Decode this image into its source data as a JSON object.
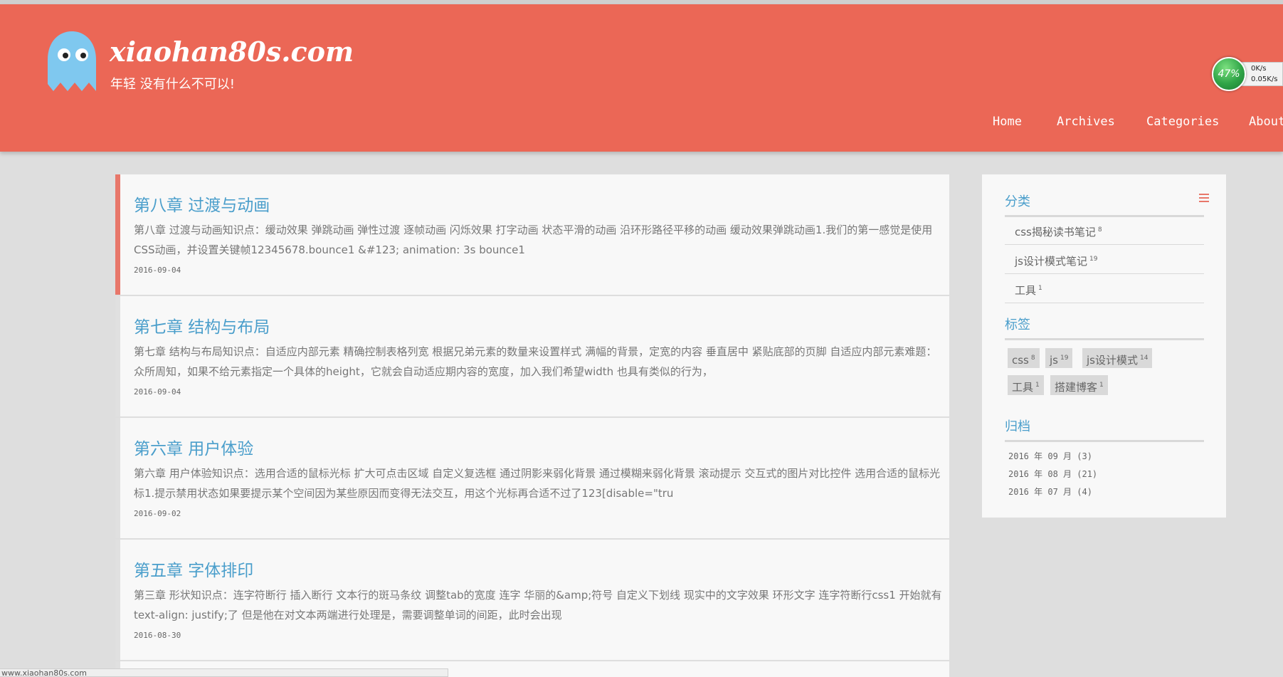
{
  "header": {
    "site_title": "xiaohan80s.com",
    "subtitle": "年轻 没有什么不可以!",
    "brand_color": "#eb6756",
    "nav": [
      {
        "label": "Home"
      },
      {
        "label": "Archives"
      },
      {
        "label": "Categories"
      },
      {
        "label": "About"
      }
    ]
  },
  "speed_widget": {
    "percent": "47%",
    "upload": "0K/s",
    "download": "0.05K/s"
  },
  "posts": [
    {
      "title": "第八章 过渡与动画",
      "excerpt": "第八章 过渡与动画知识点：缓动效果 弹跳动画 弹性过渡 逐帧动画 闪烁效果 打字动画 状态平滑的动画 沿环形路径平移的动画 缓动效果弹跳动画1.我们的第一感觉是使用CSS动画，并设置关键帧12345678.bounce1 &#123; animation: 3s bounce1",
      "date": "2016-09-04"
    },
    {
      "title": "第七章 结构与布局",
      "excerpt": "第七章 结构与布局知识点：自适应内部元素 精确控制表格列宽 根据兄弟元素的数量来设置样式 满幅的背景，定宽的内容 垂直居中 紧贴底部的页脚 自适应内部元素难题：众所周知，如果不给元素指定一个具体的height，它就会自动适应期内容的宽度，加入我们希望width 也具有类似的行为，",
      "date": "2016-09-04"
    },
    {
      "title": "第六章 用户体验",
      "excerpt": "第六章 用户体验知识点：选用合适的鼠标光标 扩大可点击区域 自定义复选框 通过阴影来弱化背景 通过模糊来弱化背景 滚动提示 交互式的图片对比控件 选用合适的鼠标光标1.提示禁用状态如果要提示某个空间因为某些原因而变得无法交互，用这个光标再合适不过了123[disable=\"tru",
      "date": "2016-09-02"
    },
    {
      "title": "第五章 字体排印",
      "excerpt": "第三章 形状知识点：连字符断行 插入断行 文本行的斑马条纹 调整tab的宽度 连字 华丽的&amp;符号 自定义下划线 现实中的文字效果 环形文字 连字符断行css1 开始就有text-align: justify;了 但是他在对文本两端进行处理是，需要调整单词的间距，此时会出现",
      "date": "2016-08-30"
    }
  ],
  "sidebar": {
    "categories_heading": "分类",
    "categories": [
      {
        "name": "css揭秘读书笔记",
        "count": "8"
      },
      {
        "name": "js设计模式笔记",
        "count": "19"
      },
      {
        "name": "工具",
        "count": "1"
      }
    ],
    "tags_heading": "标签",
    "tags": [
      {
        "name": "css",
        "count": "8"
      },
      {
        "name": "js",
        "count": "19"
      },
      {
        "name": "js设计模式",
        "count": "14"
      },
      {
        "name": "工具",
        "count": "1"
      },
      {
        "name": "搭建博客",
        "count": "1"
      }
    ],
    "archives_heading": "归档",
    "archives": [
      {
        "label": "2016 年 09 月 (3)"
      },
      {
        "label": "2016 年 08 月 (21)"
      },
      {
        "label": "2016 年 07 月 (4)"
      }
    ]
  },
  "status_bar": {
    "url": "www.xiaohan80s.com"
  }
}
